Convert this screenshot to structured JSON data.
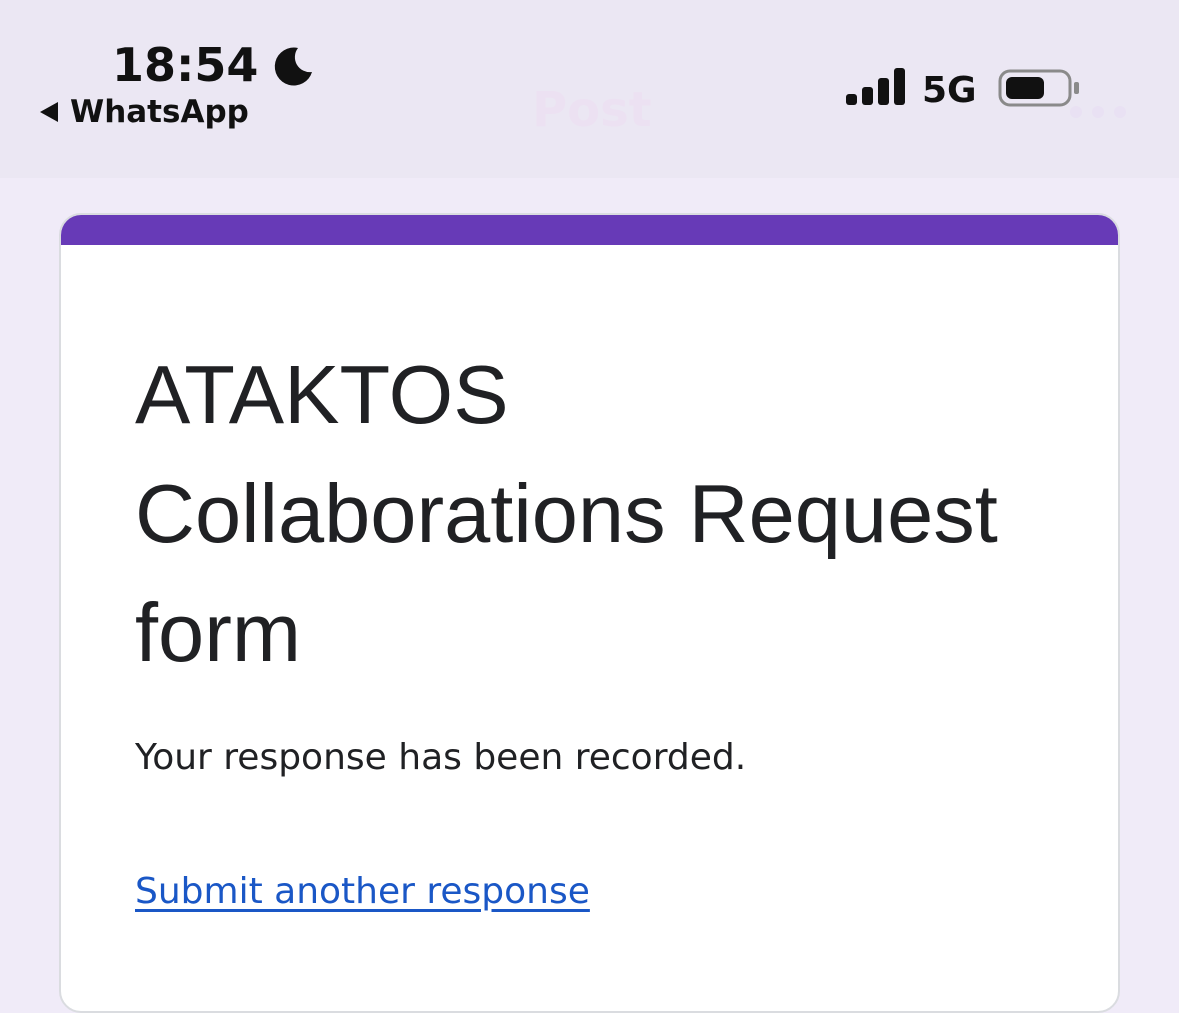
{
  "status_bar": {
    "time": "18:54",
    "back_app_label": "WhatsApp",
    "ghost_title": "Post",
    "network": "5G",
    "focus_icon": "moon-icon",
    "signal_icon": "signal-bars-icon",
    "battery_icon": "battery-icon",
    "back_icon": "back-arrow-icon"
  },
  "form": {
    "title": "ATAKTOS Collaborations Request form",
    "confirmation_message": "Your response has been recorded.",
    "submit_another_label": "Submit another response"
  },
  "colors": {
    "page_background": "#f0ebf8",
    "accent": "#673ab7",
    "link": "#1a57c6"
  }
}
